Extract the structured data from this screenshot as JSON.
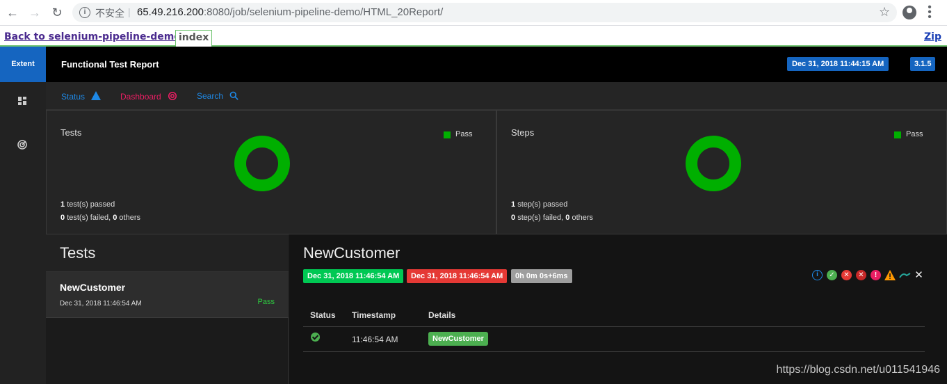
{
  "browser": {
    "security_label": "不安全",
    "url_host": "65.49.216.200",
    "url_rest": ":8080/job/selenium-pipeline-demo/HTML_20Report/"
  },
  "jenkins": {
    "back_label": "Back to selenium-pipeline-demo",
    "index_label": "index",
    "zip_label": "Zip"
  },
  "report": {
    "brand": "Extent",
    "title": "Functional Test Report",
    "report_date": "Dec 31, 2018 11:44:15 AM",
    "version": "3.1.5",
    "nav": [
      {
        "label": "Status",
        "color": "#1e88e5"
      },
      {
        "label": "Dashboard",
        "color": "#e91e63"
      },
      {
        "label": "Search",
        "color": "#1e88e5"
      }
    ],
    "panels": [
      {
        "title": "Tests",
        "legend": "Pass",
        "passed": "1",
        "passed_text": "test(s) passed",
        "failed": "0",
        "failed_text": "test(s) failed,",
        "others": "0",
        "others_text": "others",
        "pass_fraction": 1
      },
      {
        "title": "Steps",
        "legend": "Pass",
        "passed": "1",
        "passed_text": "step(s) passed",
        "failed": "0",
        "failed_text": "step(s) failed,",
        "others": "0",
        "others_text": "others",
        "pass_fraction": 1
      }
    ],
    "tests_heading": "Tests",
    "test_item": {
      "name": "NewCustomer",
      "time": "Dec 31, 2018 11:46:54 AM",
      "status": "Pass"
    },
    "detail": {
      "name": "NewCustomer",
      "start": "Dec 31, 2018 11:46:54 AM",
      "end": "Dec 31, 2018 11:46:54 AM",
      "duration": "0h 0m 0s+6ms",
      "columns": [
        "Status",
        "Timestamp",
        "Details"
      ],
      "row": {
        "timestamp": "11:46:54 AM",
        "details": "NewCustomer"
      }
    }
  },
  "watermark": "https://blog.csdn.net/u011541946",
  "colors": {
    "pass": "#00af00",
    "brand": "#1565c0",
    "start": "#00c853",
    "end": "#e53935",
    "duration": "#9e9e9e"
  }
}
